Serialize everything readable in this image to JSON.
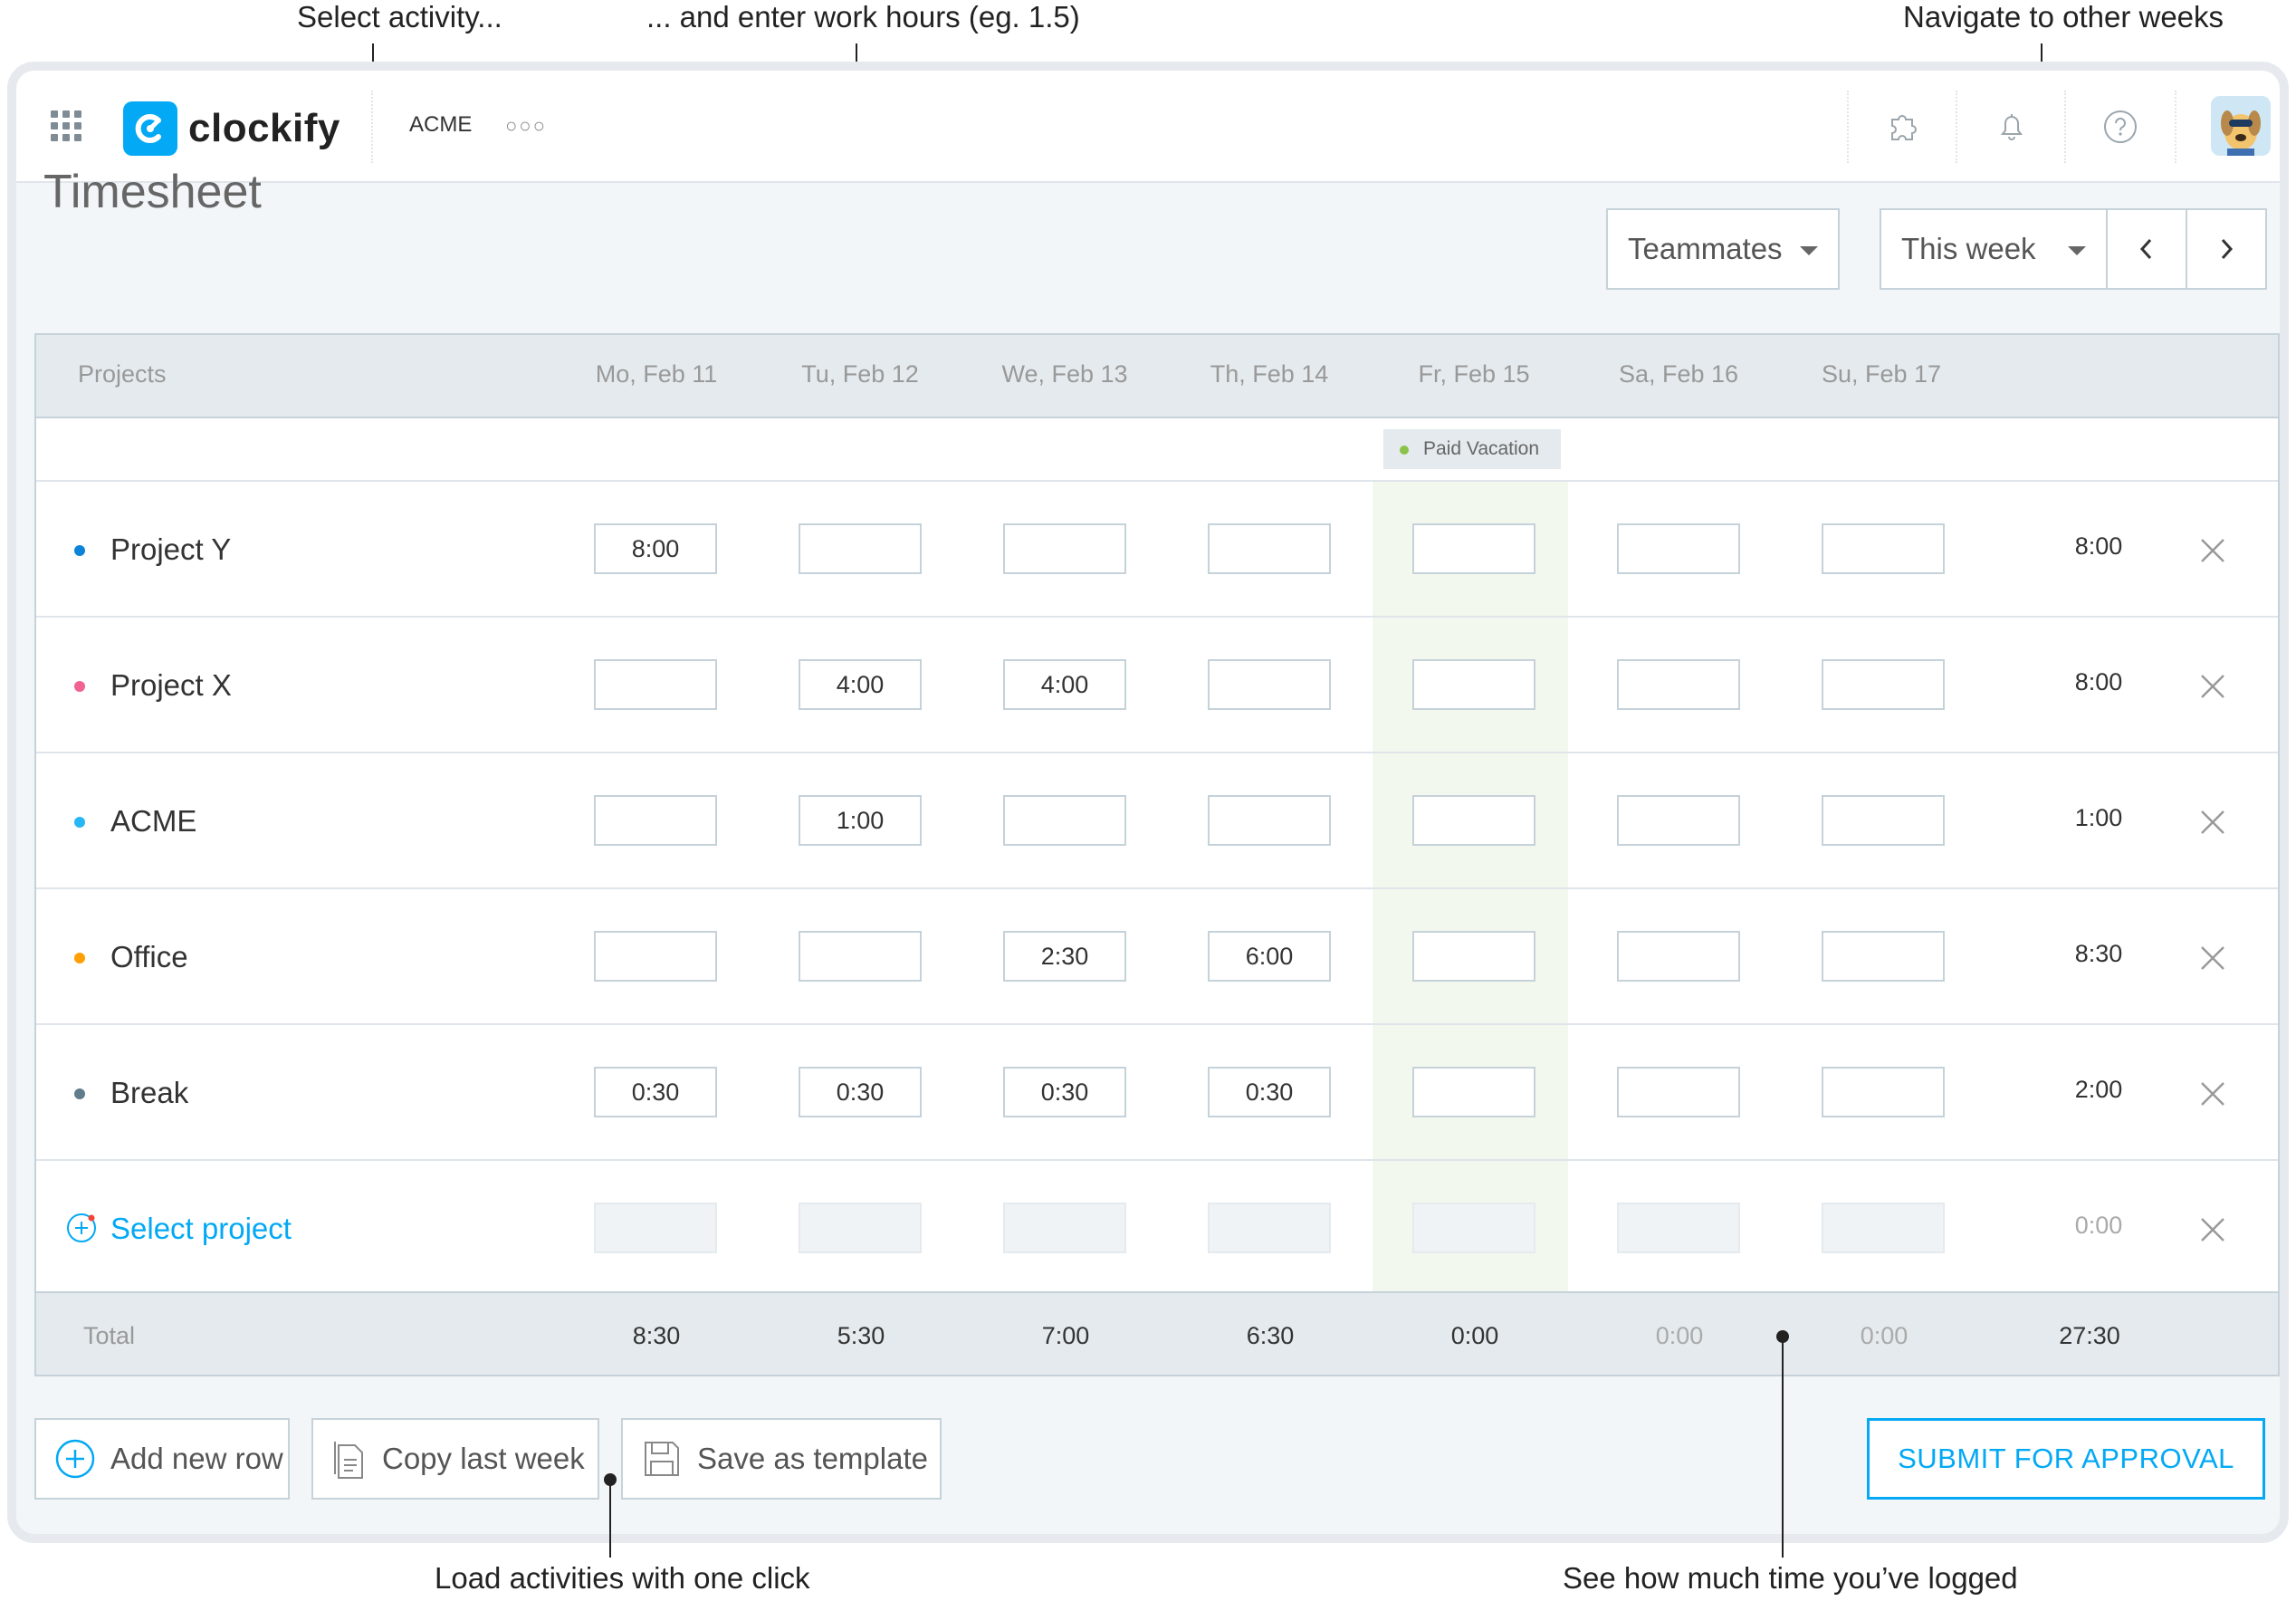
{
  "annotations": {
    "select_activity": "Select activity...",
    "enter_hours": "... and enter work hours (eg. 1.5)",
    "navigate": "Navigate to other weeks",
    "load_activities": "Load activities with one click",
    "see_time": "See how much time you’ve logged"
  },
  "topbar": {
    "logo_text": "clockify",
    "workspace": "ACME",
    "more_icon": "more-dots-icon",
    "icons": [
      "puzzle-icon",
      "bell-icon",
      "help-icon"
    ]
  },
  "page": {
    "title": "Timesheet",
    "teammates_label": "Teammates",
    "week_label": "This week"
  },
  "table": {
    "projects_header": "Projects",
    "days": [
      "Mo, Feb 11",
      "Tu, Feb 12",
      "We, Feb 13",
      "Th, Feb 14",
      "Fr, Feb 15",
      "Sa, Feb 16",
      "Su, Feb 17"
    ],
    "paid_vacation": "Paid Vacation",
    "rows": [
      {
        "name": "Project Y",
        "color": "#0b83d9",
        "cells": [
          "8:00",
          "",
          "",
          "",
          "",
          "",
          ""
        ],
        "total": "8:00"
      },
      {
        "name": "Project X",
        "color": "#f06292",
        "cells": [
          "",
          "4:00",
          "4:00",
          "",
          "",
          "",
          ""
        ],
        "total": "8:00"
      },
      {
        "name": "ACME",
        "color": "#29b6f6",
        "cells": [
          "",
          "1:00",
          "",
          "",
          "",
          "",
          ""
        ],
        "total": "1:00"
      },
      {
        "name": "Office",
        "color": "#ffa000",
        "cells": [
          "",
          "",
          "2:30",
          "6:00",
          "",
          "",
          ""
        ],
        "total": "8:30"
      },
      {
        "name": "Break",
        "color": "#607d8b",
        "cells": [
          "0:30",
          "0:30",
          "0:30",
          "0:30",
          "",
          "",
          ""
        ],
        "total": "2:00"
      }
    ],
    "select_project": "Select project",
    "select_project_total": "0:00",
    "total_label": "Total",
    "totals": [
      "8:30",
      "5:30",
      "7:00",
      "6:30",
      "0:00",
      "0:00",
      "0:00"
    ],
    "grand_total": "27:30"
  },
  "actions": {
    "add_row": "Add new row",
    "copy_week": "Copy last week",
    "save_template": "Save as template",
    "submit": "SUBMIT FOR APPROVAL"
  },
  "colors": {
    "accent": "#03a9f4",
    "vacation": "#8bc34a"
  }
}
